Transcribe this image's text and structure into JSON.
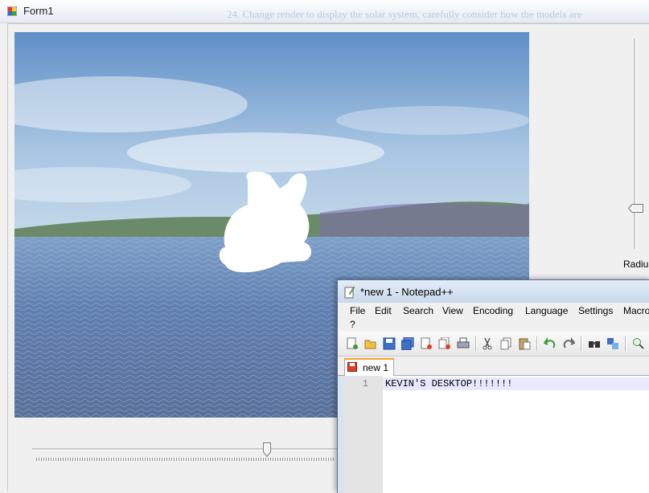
{
  "form1": {
    "title": "Form1",
    "background_doc_text": "24. Change render to display the solar system, carefully consider how the models are"
  },
  "viewport": {
    "description_icon": "bunny-model"
  },
  "trackbars": {
    "horizontal_value": 0.76,
    "vertical_value": 0.8,
    "radius_label": "Radius"
  },
  "notepad": {
    "title": "*new 1 - Notepad++",
    "menu": [
      "File",
      "Edit",
      "Search",
      "View",
      "Encoding",
      "Language",
      "Settings",
      "Macro",
      "?"
    ],
    "tab_label": "new 1",
    "line_number": "1",
    "line_text": "KEVIN'S DESKTOP!!!!!!!"
  },
  "colors": {
    "tab_accent": "#f7a128",
    "current_line": "#e8e8ff"
  }
}
